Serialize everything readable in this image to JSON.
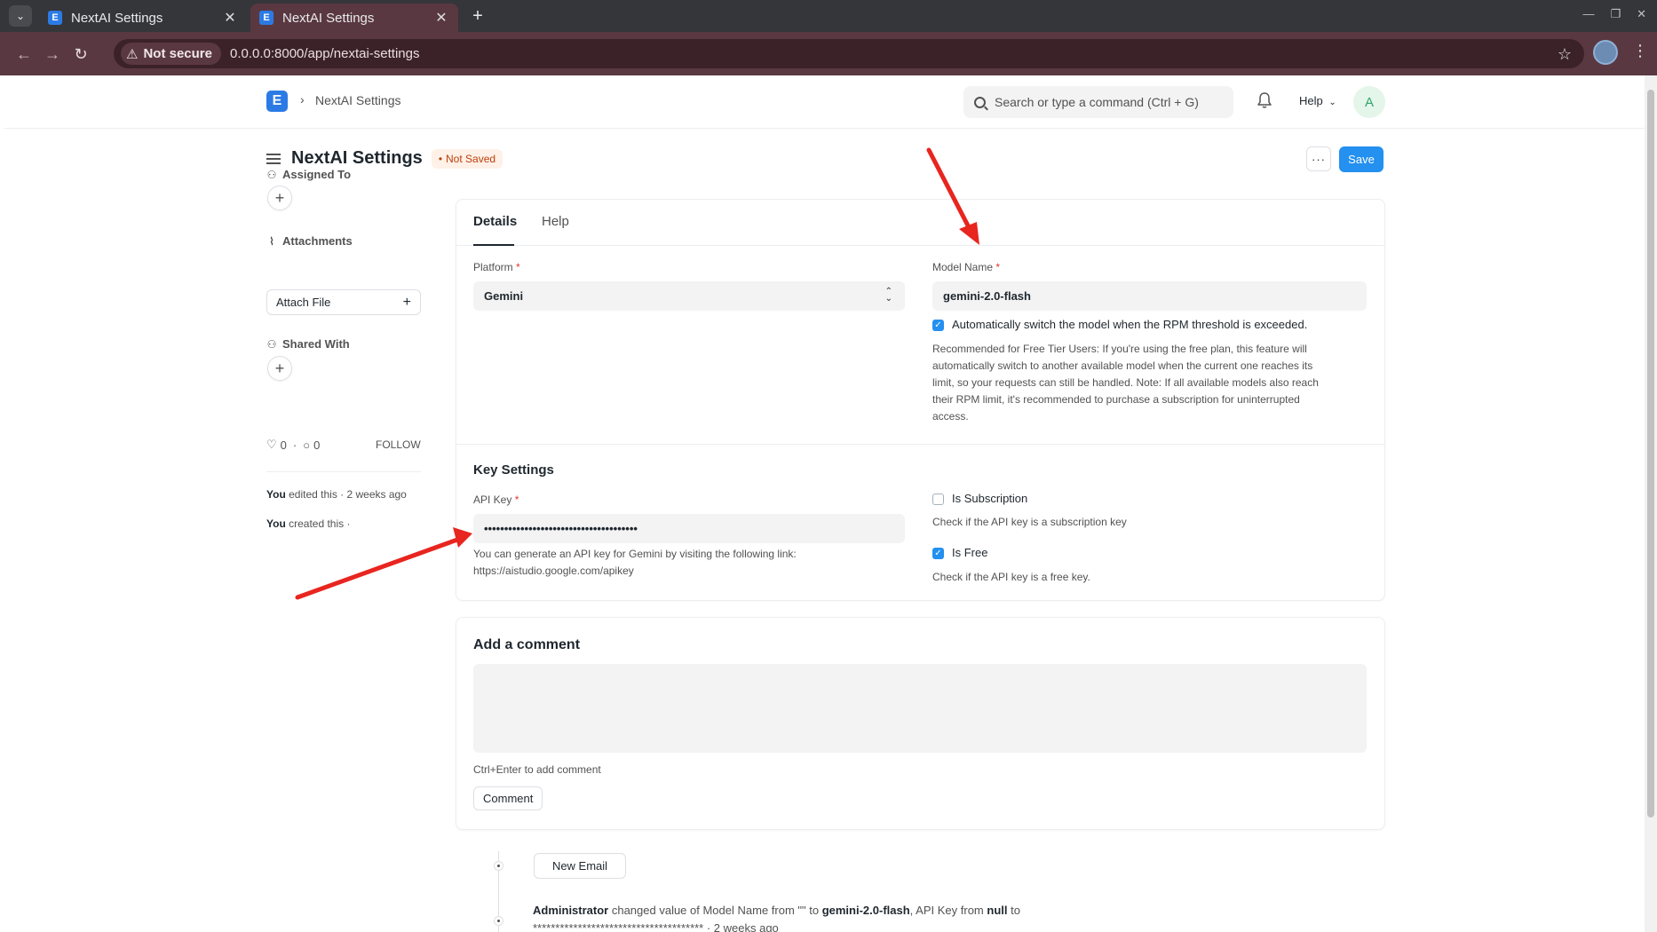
{
  "browser": {
    "tabs": [
      {
        "title": "NextAI Settings",
        "favicon": "E"
      },
      {
        "title": "NextAI Settings",
        "favicon": "E"
      }
    ],
    "security_label": "Not secure",
    "url": "0.0.0.0:8000/app/nextai-settings"
  },
  "navbar": {
    "logo": "E",
    "breadcrumb": "NextAI Settings",
    "search_placeholder": "Search or type a command (Ctrl + G)",
    "help_label": "Help",
    "avatar_initial": "A"
  },
  "page": {
    "title": "NextAI Settings",
    "status": "Not Saved",
    "more_label": "···",
    "save_label": "Save"
  },
  "sidebar": {
    "assigned_to": "Assigned To",
    "attachments": "Attachments",
    "attach_file": "Attach File",
    "shared_with": "Shared With",
    "likes_count": "0",
    "comments_count": "0",
    "follow_label": "FOLLOW",
    "activity": [
      {
        "who": "You",
        "text": " edited this · 2 weeks ago"
      },
      {
        "who": "You",
        "text": " created this ·"
      }
    ]
  },
  "form": {
    "tabs": [
      "Details",
      "Help"
    ],
    "platform_label": "Platform",
    "platform_value": "Gemini",
    "model_name_label": "Model Name",
    "model_name_value": "gemini-2.0-flash",
    "auto_switch_label": "Automatically switch the model when the RPM threshold is exceeded.",
    "auto_switch_checked": true,
    "auto_switch_desc_1": "Recommended for Free Tier Users: If you're using the free plan, this feature will",
    "auto_switch_desc_2": "automatically switch to another available model when the current one reaches its",
    "auto_switch_desc_3": "limit, so your requests can still be handled. Note: If all available models also reach",
    "auto_switch_desc_4": "their RPM limit, it's recommended to purchase a subscription for uninterrupted",
    "auto_switch_desc_5": "access.",
    "key_section_title": "Key Settings",
    "api_key_label": "API Key",
    "api_key_value": "••••••••••••••••••••••••••••••••••••••",
    "api_key_desc_1": "You can generate an API key for Gemini by visiting the following link:",
    "api_key_desc_2": "https://aistudio.google.com/apikey",
    "is_subscription_label": "Is Subscription",
    "is_subscription_checked": false,
    "is_subscription_desc": "Check if the API key is a subscription key",
    "is_free_label": "Is Free",
    "is_free_checked": true,
    "is_free_desc": "Check if the API key is a free key."
  },
  "comment": {
    "title": "Add a comment",
    "hint": "Ctrl+Enter to add comment",
    "button": "Comment"
  },
  "timeline": {
    "new_email": "New Email",
    "entry_actor": "Administrator",
    "entry_part1": " changed value of Model Name from \"\" to ",
    "entry_value1": "gemini-2.0-flash",
    "entry_part2": ", API Key from ",
    "entry_value2": "null",
    "entry_part3": " to",
    "entry_line2": "************************************** · 2 weeks ago"
  },
  "colors": {
    "primary": "#2490ef",
    "annotation_arrow": "#e8251f",
    "status_badge_text": "#bd3e0c",
    "browser_toolbar": "#5a3841"
  }
}
